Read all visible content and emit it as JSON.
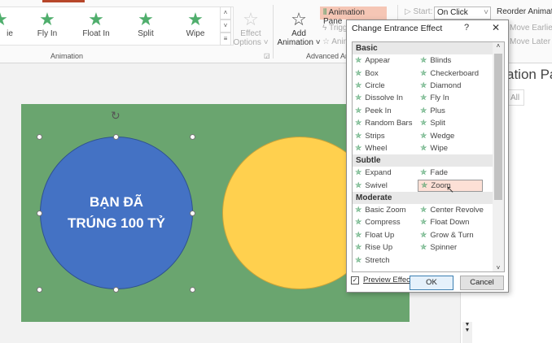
{
  "ribbon": {
    "gallery": [
      "ie",
      "Fly In",
      "Float In",
      "Split",
      "Wipe"
    ],
    "effect_options": [
      "Effect",
      "Options ˅"
    ],
    "animation_group": "Animation",
    "add_animation": [
      "Add",
      "Animation ˅"
    ],
    "animation_pane": "Animation Pane",
    "trigger": "Trigg",
    "animation_painter": "Anin",
    "advanced_group": "Advanced Anin",
    "start_label": "Start:",
    "start_value": "On Click",
    "reorder": "Reorder Animatio",
    "move_earlier": "Move Earlier",
    "move_later": "Move Later"
  },
  "slide": {
    "text_line1": "BẠN ĐÃ",
    "text_line2": "TRÚNG 100 TỶ"
  },
  "right_pane": {
    "title": "ation Pa",
    "play_all": "All"
  },
  "dialog": {
    "title": "Change Entrance Effect",
    "help": "?",
    "close": "✕",
    "categories": [
      {
        "name": "Basic",
        "items": [
          "Appear",
          "Blinds",
          "Box",
          "Checkerboard",
          "Circle",
          "Diamond",
          "Dissolve In",
          "Fly In",
          "Peek In",
          "Plus",
          "Random Bars",
          "Split",
          "Strips",
          "Wedge",
          "Wheel",
          "Wipe"
        ]
      },
      {
        "name": "Subtle",
        "items": [
          "Expand",
          "Fade",
          "Swivel",
          "Zoom"
        ]
      },
      {
        "name": "Moderate",
        "items": [
          "Basic Zoom",
          "Center Revolve",
          "Compress",
          "Float Down",
          "Float Up",
          "Grow & Turn",
          "Rise Up",
          "Spinner",
          "Stretch"
        ]
      }
    ],
    "selected": "Zoom",
    "preview_label": "Preview Effect",
    "preview_checked": true,
    "ok": "OK",
    "cancel": "Cancel"
  }
}
